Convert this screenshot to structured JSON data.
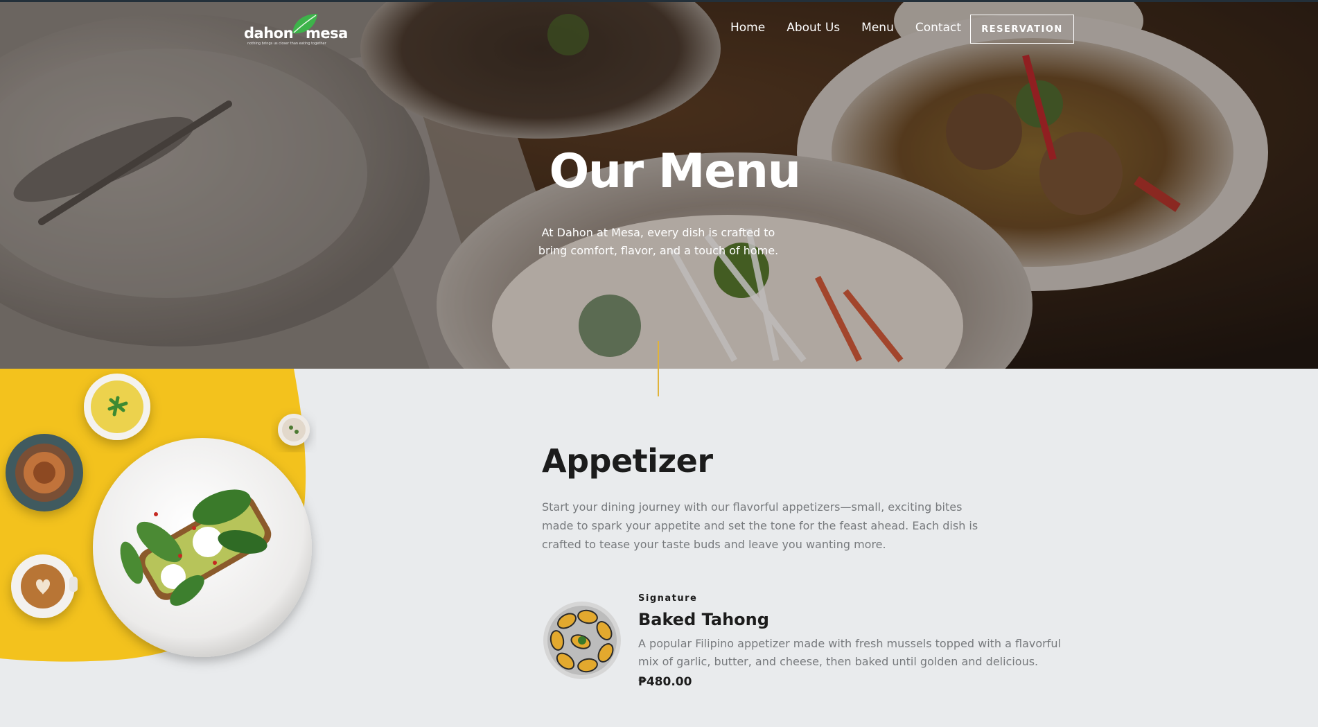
{
  "brand": {
    "logo_word_1": "dahon",
    "logo_word_2": "mesa",
    "tagline": "nothing brings us closer than eating together"
  },
  "nav": {
    "items": [
      {
        "label": "Home"
      },
      {
        "label": "About Us"
      },
      {
        "label": "Menu"
      },
      {
        "label": "Contact"
      }
    ],
    "cta_label": "RESERVATION"
  },
  "hero": {
    "title": "Our Menu",
    "subtitle": "At Dahon at Mesa, every dish is crafted to bring comfort, flavor, and a touch of home."
  },
  "section": {
    "title": "Appetizer",
    "description": "Start your dining journey with our flavorful appetizers—small, exciting bites made to spark your appetite and set the tone for the feast ahead. Each dish is crafted to tease your taste buds and leave you wanting more."
  },
  "menu_items": [
    {
      "tag": "Signature",
      "name": "Baked Tahong",
      "description": "A popular Filipino appetizer made with fresh mussels topped with a flavorful mix of garlic, butter, and cheese, then baked until golden and delicious.",
      "price": "₱480.00"
    }
  ],
  "colors": {
    "accent_yellow": "#f3c21d",
    "divider_gold": "#e0b33a",
    "background": "#e9ebed",
    "heading": "#1c1c1c",
    "body_text": "#777a7d"
  }
}
